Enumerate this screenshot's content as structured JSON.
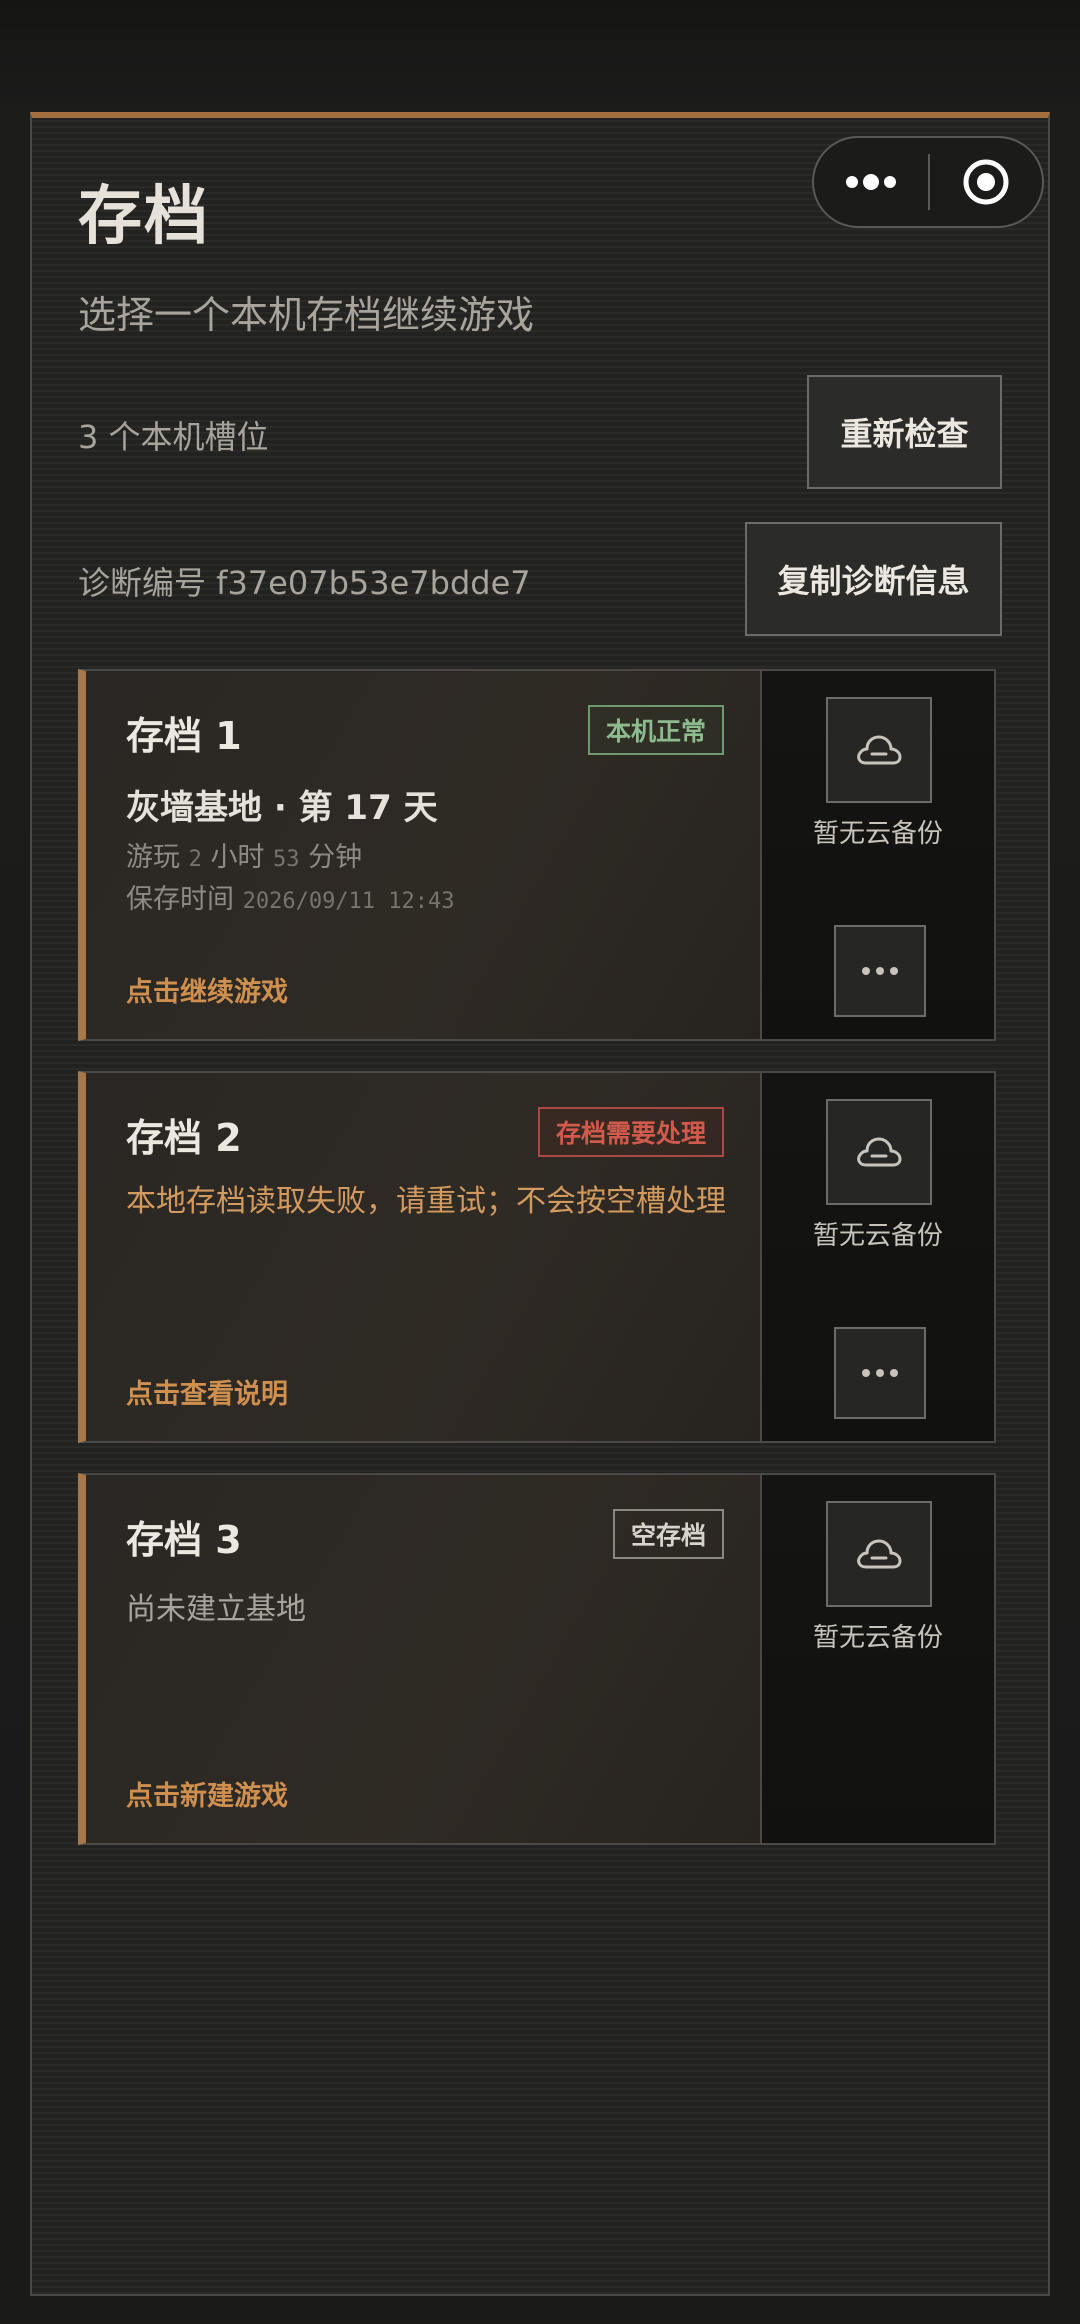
{
  "page": {
    "title": "存档",
    "subtitle": "选择一个本机存档继续游戏",
    "slot_count": "3 个本机槽位",
    "diagnostic": "诊断编号 f37e07b53e7bdde7"
  },
  "buttons": {
    "recheck": "重新检查",
    "copy_diag": "复制诊断信息"
  },
  "icons": {
    "menu": "more-dots-icon",
    "close": "target-circle-icon",
    "cloud": "cloud-icon",
    "more": "ellipsis-icon"
  },
  "colors": {
    "accent": "#a9784a",
    "action": "#cf8f4f",
    "ok": "#8dbb8e",
    "warn": "#d05a4c"
  },
  "saves": [
    {
      "name": "存档 1",
      "status": "本机正常",
      "base": "灰墙基地 · 第 17 天",
      "play_label_a": "游玩",
      "play_hours": "2",
      "play_label_b": "小时",
      "play_minutes": "53",
      "play_label_c": "分钟",
      "saved_label": "保存时间",
      "saved_time": "2026/09/11 12:43",
      "action": "点击继续游戏",
      "cloud": "暂无云备份"
    },
    {
      "name": "存档 2",
      "status": "存档需要处理",
      "message": "本地存档读取失败，请重试；不会按空槽处理",
      "action": "点击查看说明",
      "cloud": "暂无云备份"
    },
    {
      "name": "存档 3",
      "status": "空存档",
      "message": "尚未建立基地",
      "action": "点击新建游戏",
      "cloud": "暂无云备份"
    }
  ]
}
